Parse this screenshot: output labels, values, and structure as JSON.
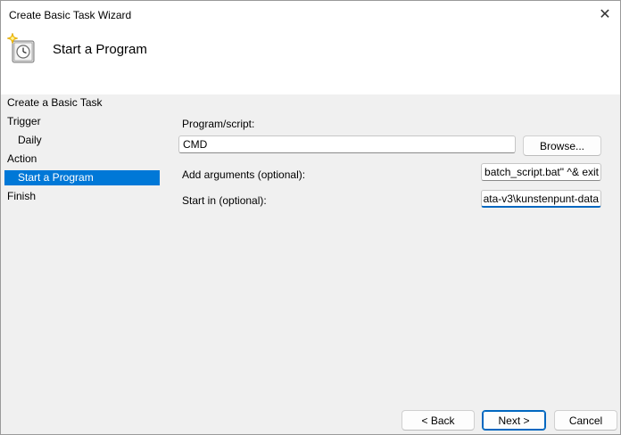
{
  "window": {
    "title": "Create Basic Task Wizard",
    "close_glyph": "✕"
  },
  "header": {
    "title": "Start a Program",
    "icon": "task-scheduler-clock-icon"
  },
  "nav": {
    "items": [
      {
        "label": "Create a Basic Task",
        "selected": false
      },
      {
        "label": "Trigger",
        "selected": false
      },
      {
        "label": "Daily",
        "selected": false
      },
      {
        "label": "Action",
        "selected": false
      },
      {
        "label": "Start a Program",
        "selected": true
      },
      {
        "label": "Finish",
        "selected": false
      }
    ]
  },
  "form": {
    "program_label": "Program/script:",
    "program_value": "CMD",
    "browse_label": "Browse...",
    "arguments_label": "Add arguments (optional):",
    "arguments_visible": "batch_script.bat\" ^& exit",
    "startin_label": "Start in (optional):",
    "startin_visible": "ata-v3\\kunstenpunt-data"
  },
  "buttons": {
    "back": "< Back",
    "next": "Next >",
    "cancel": "Cancel"
  },
  "colors": {
    "selection": "#0078d7",
    "focus": "#0067c0"
  }
}
